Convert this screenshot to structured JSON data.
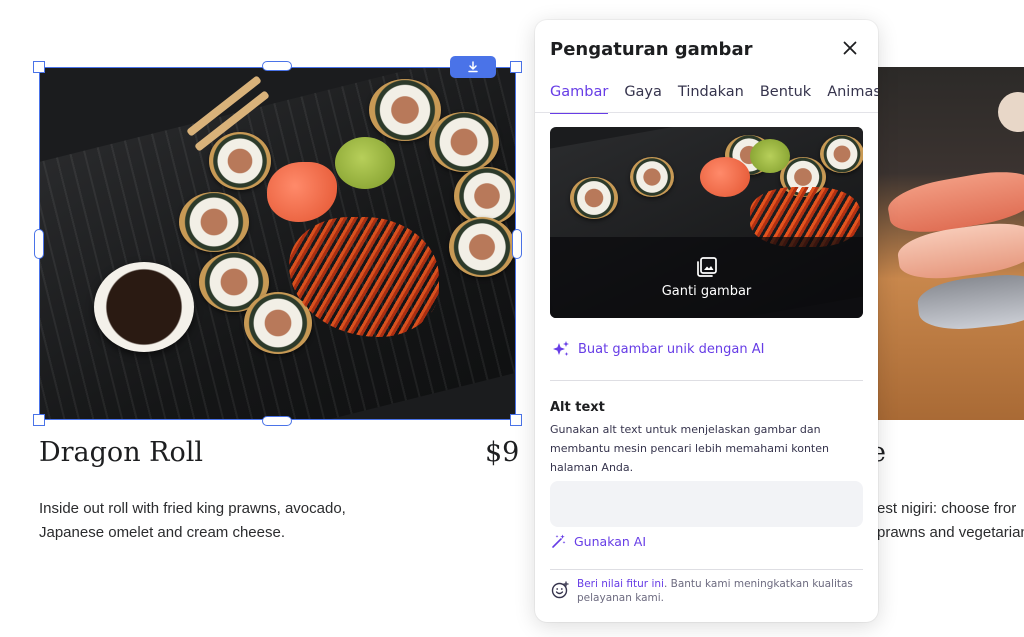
{
  "canvas": {
    "items": [
      {
        "title": "Dragon Roll",
        "price": "$9",
        "description": "Inside out roll with fried king prawns, avocado, Japanese omelet and cream cheese."
      },
      {
        "title_visible": "e",
        "description_visible_line1": "est nigiri: choose fror",
        "description_visible_line2": "prawns and vegetarian"
      }
    ]
  },
  "panel": {
    "title": "Pengaturan gambar",
    "tabs": [
      {
        "label": "Gambar",
        "active": true
      },
      {
        "label": "Gaya",
        "active": false
      },
      {
        "label": "Tindakan",
        "active": false
      },
      {
        "label": "Bentuk",
        "active": false
      },
      {
        "label": "Animasi",
        "active": false
      }
    ],
    "replace_image_label": "Ganti gambar",
    "ai_generate_label": "Buat gambar unik dengan AI",
    "alt_text": {
      "title": "Alt text",
      "help": "Gunakan alt text untuk menjelaskan gambar dan membantu mesin pencari lebih memahami konten halaman Anda.",
      "value": "",
      "placeholder": ""
    },
    "use_ai_label": "Gunakan AI",
    "feedback": {
      "link": "Beri nilai fitur ini",
      "text": ". Bantu kami meningkatkan kualitas pelayanan kami."
    }
  },
  "colors": {
    "accent": "#673de6",
    "selection": "#4a73e8"
  },
  "icons": [
    "download-icon",
    "close-icon",
    "image-gallery-icon",
    "sparkles-icon",
    "magic-wand-icon",
    "smiley-feedback-icon"
  ]
}
